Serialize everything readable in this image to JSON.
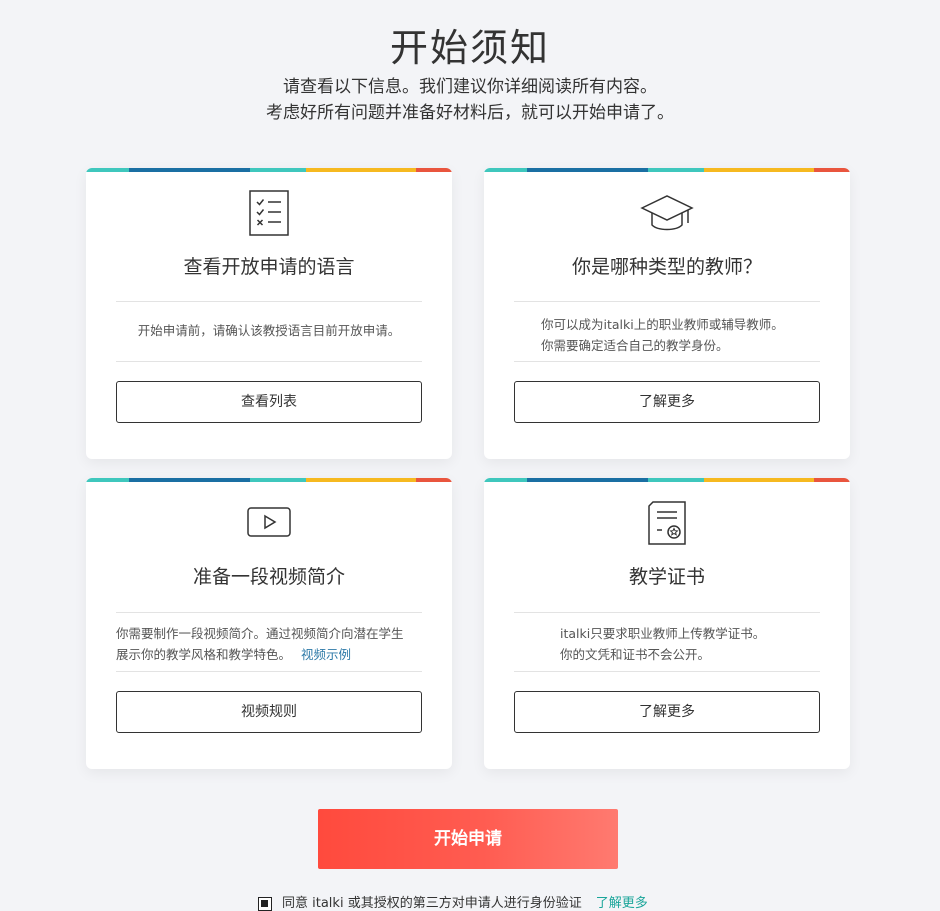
{
  "header": {
    "title": "开始须知",
    "subtitle_line1": "请查看以下信息。我们建议你详细阅读所有内容。",
    "subtitle_line2": "考虑好所有问题并准备好材料后，就可以开始申请了。"
  },
  "stripe_colors": [
    "#3fc7bd",
    "#1a6fa3",
    "#3fc7bd",
    "#f6b920",
    "#e9553e"
  ],
  "cards": [
    {
      "icon": "checklist-icon",
      "title": "查看开放申请的语言",
      "desc_line1": "开始申请前，请确认该教授语言目前开放申请。",
      "desc_line2": "",
      "button": "查看列表"
    },
    {
      "icon": "graduation-cap-icon",
      "title": "你是哪种类型的教师？",
      "desc_line1": "你可以成为italki上的职业教师或辅导教师。",
      "desc_line2": "你需要确定适合自己的教学身份。",
      "button": "了解更多"
    },
    {
      "icon": "video-play-icon",
      "title": "准备一段视频简介",
      "desc_line1": "你需要制作一段视频简介。通过视频简介向潜在学生",
      "desc_line2": "展示你的教学风格和教学特色。",
      "desc_link": "视频示例",
      "button": "视频规则"
    },
    {
      "icon": "certificate-icon",
      "title": "教学证书",
      "desc_line1": "italki只要求职业教师上传教学证书。",
      "desc_line2": "你的文凭和证书不会公开。",
      "button": "了解更多"
    }
  ],
  "start_button": "开始申请",
  "agreement": {
    "text": "同意 italki 或其授权的第三方对申请人进行身份验证",
    "link": "了解更多"
  }
}
